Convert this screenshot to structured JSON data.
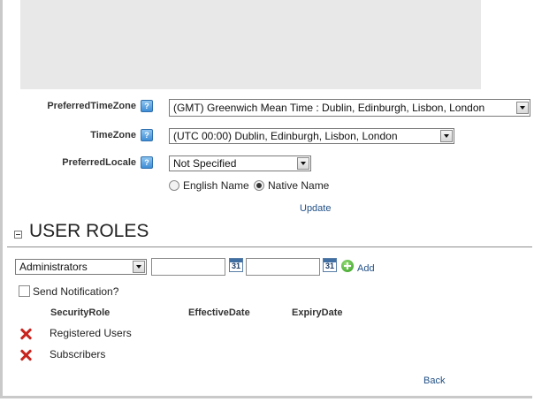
{
  "profile": {
    "preferred_timezone": {
      "label": "PreferredTimeZone",
      "value": "(GMT) Greenwich Mean Time : Dublin, Edinburgh, Lisbon, London"
    },
    "timezone": {
      "label": "TimeZone",
      "value": "(UTC 00:00) Dublin, Edinburgh, Lisbon, London"
    },
    "preferred_locale": {
      "label": "PreferredLocale",
      "value": "Not Specified"
    },
    "locale_display": {
      "options": [
        "English Name",
        "Native Name"
      ],
      "selected": "Native Name"
    },
    "update_link": "Update",
    "help_glyph": "?"
  },
  "user_roles": {
    "title": "USER ROLES",
    "role_select": "Administrators",
    "calendar_day": "31",
    "add_label": "Add",
    "send_notification_label": "Send Notification?",
    "send_notification_checked": false,
    "columns": [
      "SecurityRole",
      "EffectiveDate",
      "ExpiryDate"
    ],
    "rows": [
      {
        "role": "Registered Users",
        "effective": "",
        "expiry": ""
      },
      {
        "role": "Subscribers",
        "effective": "",
        "expiry": ""
      }
    ]
  },
  "back_link": "Back",
  "icons": {
    "help": "help-icon",
    "dropdown": "chevron-down-icon",
    "calendar": "calendar-icon",
    "add": "add-plus-icon",
    "delete": "delete-x-icon",
    "collapse": "collapse-minus-icon"
  },
  "colors": {
    "link": "#1f4f86",
    "delete": "#c8241e",
    "add": "#2f9a1e",
    "panel": "#e8e8e8"
  }
}
